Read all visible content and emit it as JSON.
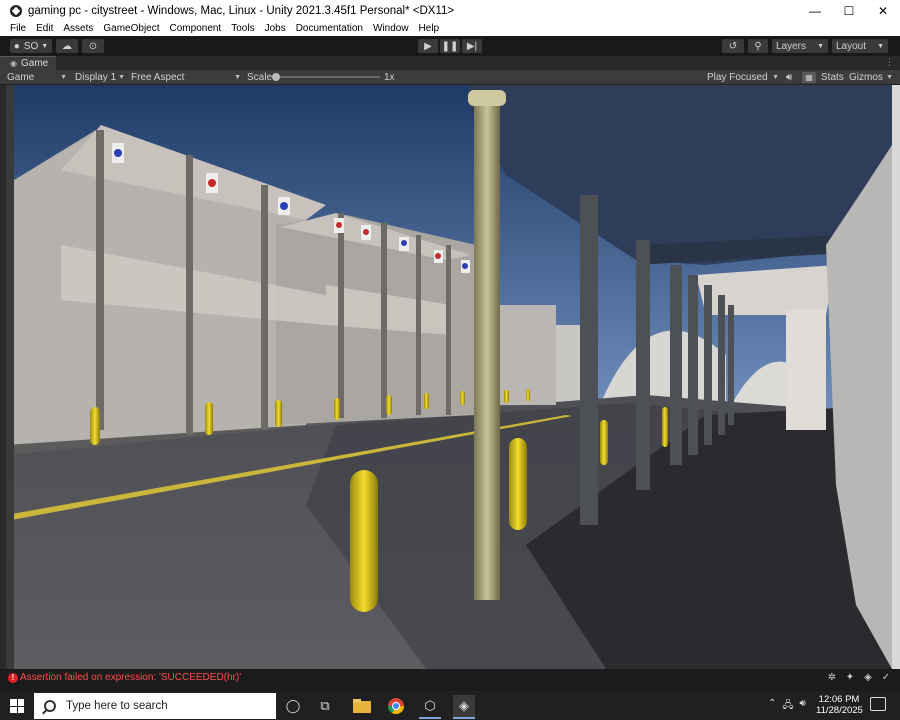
{
  "window": {
    "title": "gaming pc - citystreet - Windows, Mac, Linux - Unity 2021.3.45f1 Personal* <DX11>",
    "minimize": "—",
    "maximize": "☐",
    "close": "✕"
  },
  "menu": [
    "File",
    "Edit",
    "Assets",
    "GameObject",
    "Component",
    "Tools",
    "Jobs",
    "Documentation",
    "Window",
    "Help"
  ],
  "toolbar": {
    "account": "SO",
    "layers": "Layers",
    "layout": "Layout"
  },
  "tab": {
    "label": "Game"
  },
  "game_view": {
    "mode": "Game",
    "display": "Display 1",
    "aspect": "Free Aspect",
    "scale_label": "Scale",
    "scale_value": "1x",
    "scale_level": 0.0,
    "play_mode": "Play Focused",
    "stats": "Stats",
    "gizmos": "Gizmos"
  },
  "console": {
    "message": "Assertion failed on expression: 'SUCCEEDED(hr)'",
    "error_color": "#ff4d4d"
  },
  "taskbar": {
    "search_placeholder": "Type here to search",
    "time": "12:06 PM",
    "date": "11/28/2025",
    "icons": [
      "cortana-icon",
      "task-view-icon",
      "file-explorer-icon",
      "chrome-icon",
      "unity-hub-icon",
      "unity-editor-icon"
    ]
  }
}
